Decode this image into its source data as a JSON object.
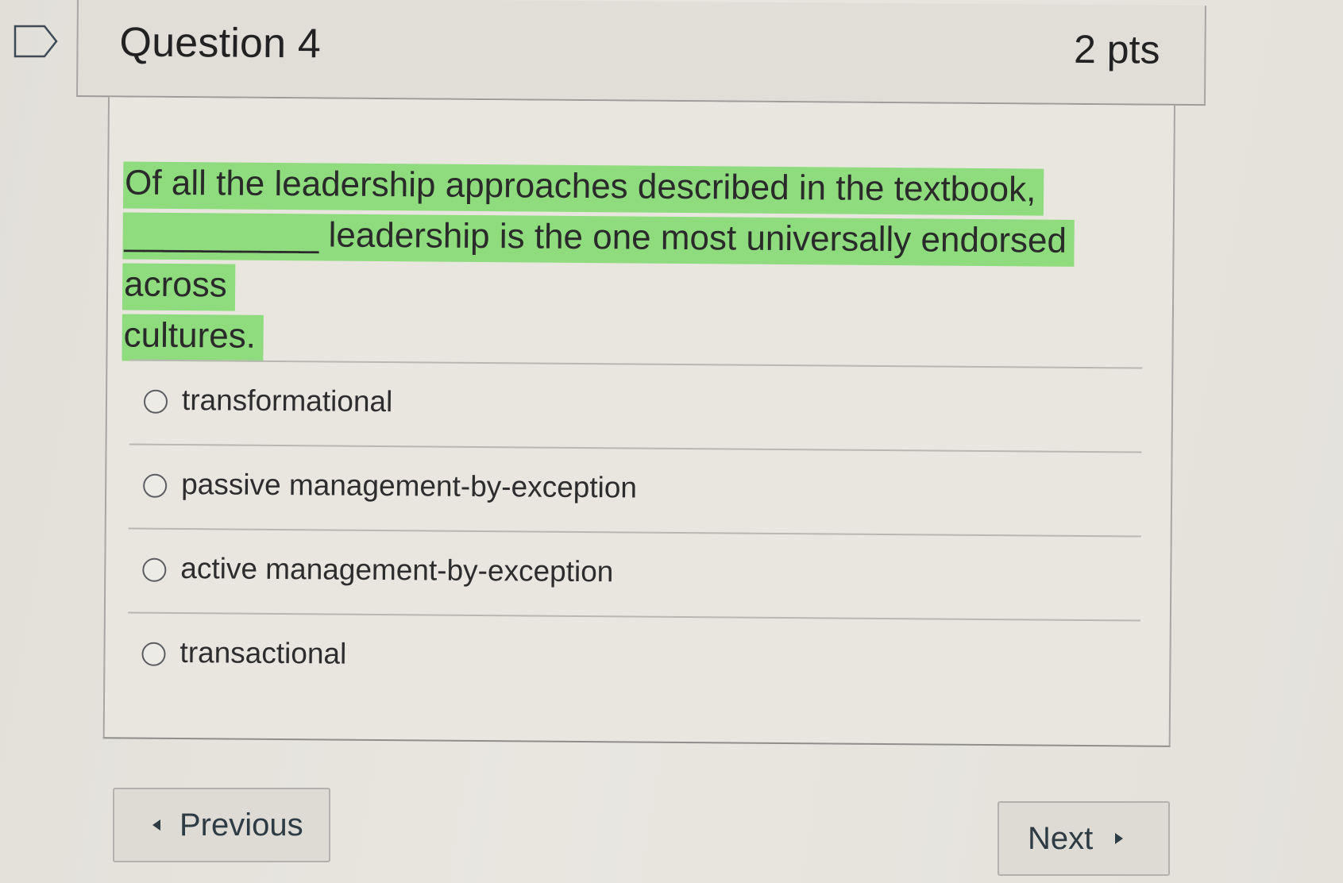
{
  "question": {
    "title": "Question 4",
    "points": "2 pts",
    "text_line_1": "Of all the leadership approaches described in the textbook,",
    "blank": "__________",
    "text_line_2": " leadership is the one most universally endorsed across",
    "text_line_3": "cultures.",
    "highlight_color": "#8fdc7f"
  },
  "answers": [
    {
      "label": "transformational"
    },
    {
      "label": "passive management-by-exception"
    },
    {
      "label": "active management-by-exception"
    },
    {
      "label": "transactional"
    }
  ],
  "navigation": {
    "previous_label": "Previous",
    "next_label": "Next"
  },
  "icons": {
    "flag": "flag-icon",
    "previous": "caret-left-icon",
    "next": "caret-right-icon"
  }
}
